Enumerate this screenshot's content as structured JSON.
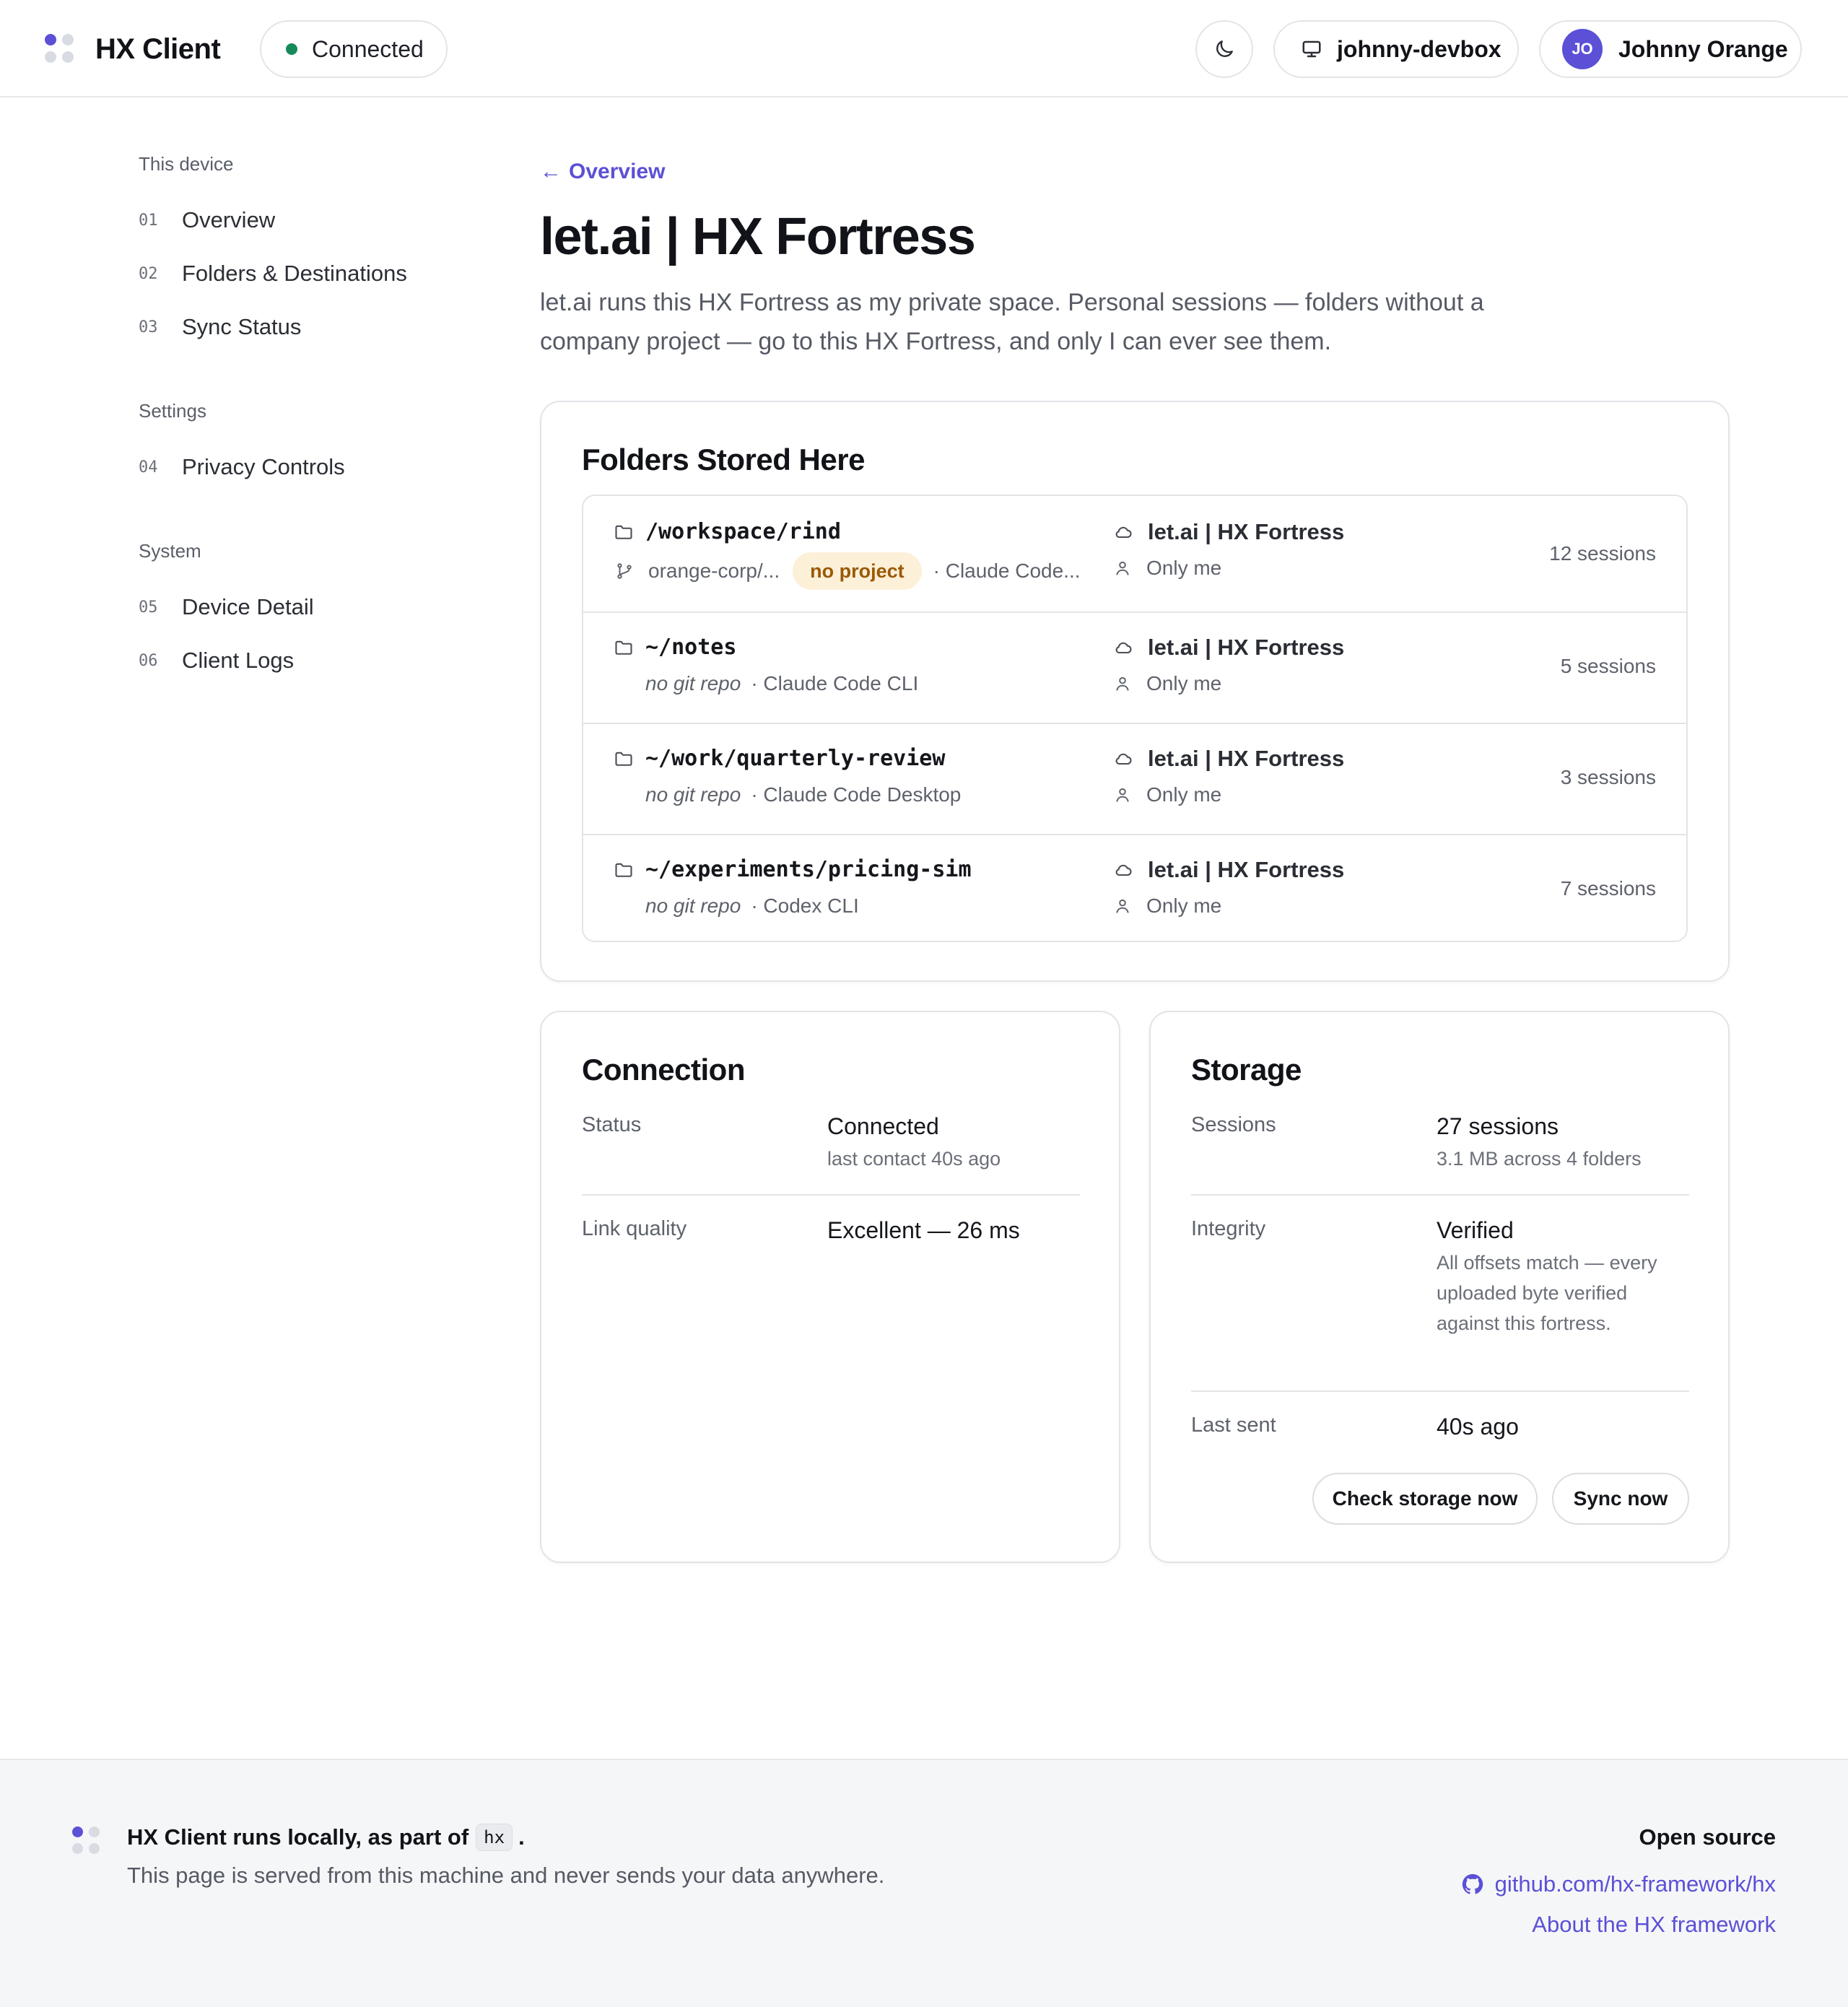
{
  "header": {
    "app_name": "HX Client",
    "status_label": "Connected",
    "theme_toggle_icon": "moon-icon",
    "device_name": "johnny-devbox",
    "user_initials": "JO",
    "user_name": "Johnny Orange"
  },
  "sidebar": {
    "groups": [
      {
        "title": "This device",
        "items": [
          {
            "num": "01",
            "label": "Overview"
          },
          {
            "num": "02",
            "label": "Folders & Destinations"
          },
          {
            "num": "03",
            "label": "Sync Status"
          }
        ]
      },
      {
        "title": "Settings",
        "items": [
          {
            "num": "04",
            "label": "Privacy Controls"
          }
        ]
      },
      {
        "title": "System",
        "items": [
          {
            "num": "05",
            "label": "Device Detail"
          },
          {
            "num": "06",
            "label": "Client Logs"
          }
        ]
      }
    ]
  },
  "main": {
    "back_label": "Overview",
    "title": "let.ai | HX Fortress",
    "description": "let.ai runs this HX Fortress as my private space. Personal sessions — folders without a company project — go to this HX Fortress, and only I can ever see them."
  },
  "folders": {
    "title": "Folders Stored Here",
    "rows": [
      {
        "path": "/workspace/rind",
        "repo": "orange-corp/...",
        "badge": "no project",
        "tool": "· Claude Code...",
        "destination": "let.ai | HX Fortress",
        "visibility": "Only me",
        "sessions": "12 sessions"
      },
      {
        "path": "~/notes",
        "no_git": "no git repo",
        "tool": "· Claude Code CLI",
        "destination": "let.ai | HX Fortress",
        "visibility": "Only me",
        "sessions": "5 sessions"
      },
      {
        "path": "~/work/quarterly-review",
        "no_git": "no git repo",
        "tool": "· Claude Code Desktop",
        "destination": "let.ai | HX Fortress",
        "visibility": "Only me",
        "sessions": "3 sessions"
      },
      {
        "path": "~/experiments/pricing-sim",
        "no_git": "no git repo",
        "tool": "· Codex CLI",
        "destination": "let.ai | HX Fortress",
        "visibility": "Only me",
        "sessions": "7 sessions"
      }
    ]
  },
  "connection": {
    "title": "Connection",
    "status_key": "Status",
    "status_value": "Connected",
    "status_sub": "last contact 40s ago",
    "link_key": "Link quality",
    "link_value": "Excellent — 26 ms"
  },
  "storage": {
    "title": "Storage",
    "sessions_key": "Sessions",
    "sessions_value": "27 sessions",
    "sessions_sub": "3.1 MB across 4 folders",
    "integrity_key": "Integrity",
    "integrity_value": "Verified",
    "integrity_sub": "All offsets match — every uploaded byte verified against this fortress.",
    "last_sent_key": "Last sent",
    "last_sent_value": "40s ago",
    "check_button": "Check storage now",
    "sync_button": "Sync now"
  },
  "footer": {
    "line1_prefix": "HX Client runs locally, as part of",
    "code": "hx",
    "line1_suffix": ".",
    "line2": "This page is served from this machine and never sends your data anywhere.",
    "open_source_title": "Open source",
    "github_link": "github.com/hx-framework/hx",
    "about_link": "About the HX framework"
  },
  "colors": {
    "accent": "#5b50d6",
    "connected": "#178a5c",
    "badge_bg": "#fdf0d8",
    "badge_text": "#9a5a06"
  }
}
